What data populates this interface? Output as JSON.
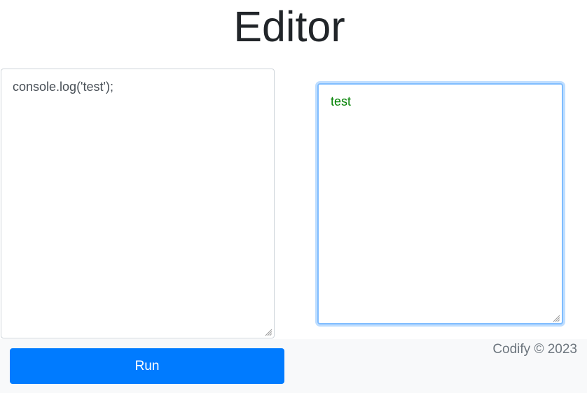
{
  "header": {
    "title": "Editor"
  },
  "editor": {
    "code": "console.log('test');"
  },
  "output": {
    "text": "test",
    "text_color": "#008000"
  },
  "actions": {
    "run_label": "Run"
  },
  "footer": {
    "copyright": "Codify © 2023"
  },
  "colors": {
    "primary": "#007bff",
    "focus_border": "#80bdff",
    "footer_background": "#f8f9fa",
    "muted_text": "#6c757d"
  },
  "icons": {
    "resize_handle": "resize-grip-icon"
  }
}
